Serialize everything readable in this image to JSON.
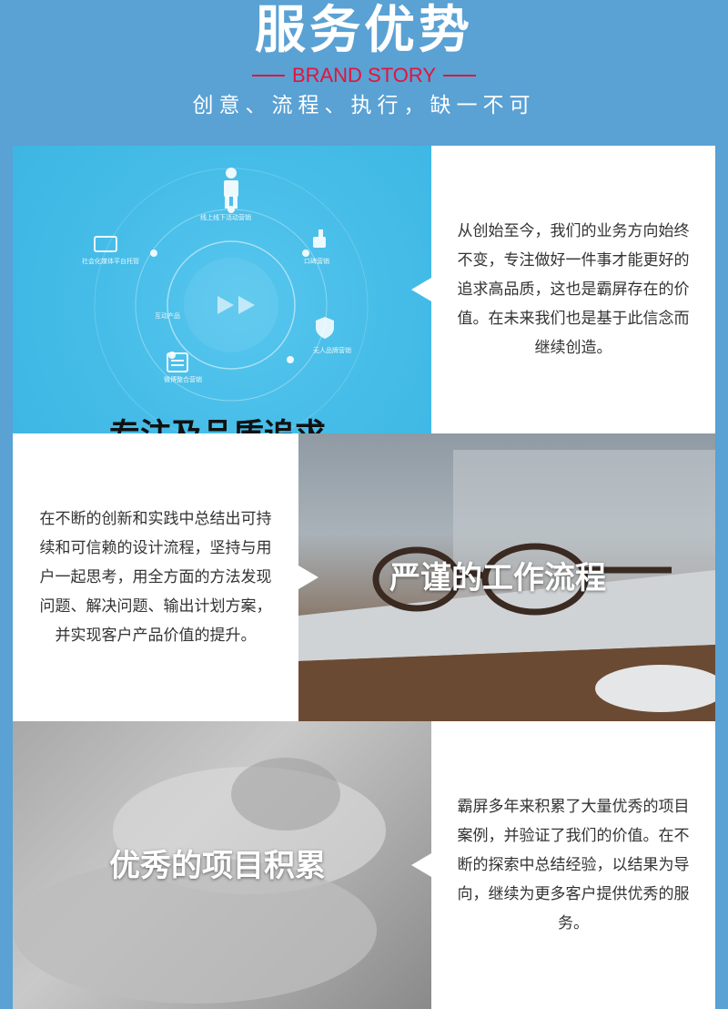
{
  "header": {
    "title": "服务优势",
    "brand": "BRAND STORY",
    "subtitle": "创意、流程、执行，缺一不可"
  },
  "sections": [
    {
      "caption": "专注及品质追求",
      "text": "从创始至今，我们的业务方向始终不变，专注做好一件事才能更好的追求高品质，这也是霸屏存在的价值。在未来我们也是基于此信念而继续创造。",
      "diagram_labels": [
        "线上线下活动营销",
        "社会化媒体平台托管",
        "口碑营销",
        "互动产品",
        "无人品牌营销",
        "微博整合营销"
      ]
    },
    {
      "caption": "严谨的工作流程",
      "text": "在不断的创新和实践中总结出可持续和可信赖的设计流程，坚持与用户一起思考，用全方面的方法发现问题、解决问题、输出计划方案，并实现客户产品价值的提升。"
    },
    {
      "caption": "优秀的项目积累",
      "text": "霸屏多年来积累了大量优秀的项目案例，并验证了我们的价值。在不断的探索中总结经验，以结果为导向，继续为更多客户提供优秀的服务。"
    }
  ],
  "colors": {
    "background": "#5aa1d4",
    "brand_red": "#e4133a",
    "panel_blue": "#46bde8"
  }
}
